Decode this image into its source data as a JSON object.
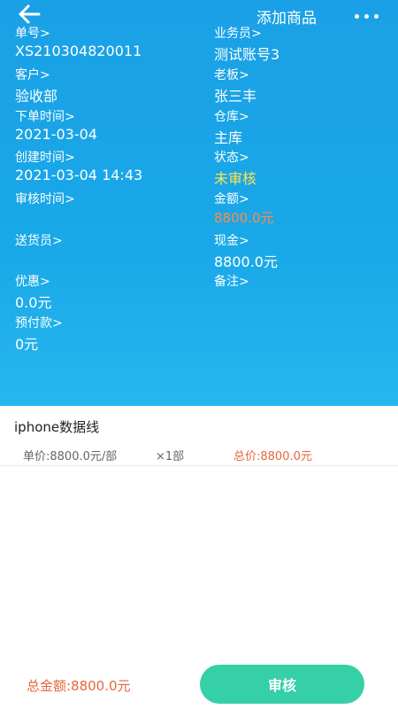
{
  "header": {
    "title": "添加商品"
  },
  "order": {
    "number_label": "单号>",
    "number_value": "XS210304820011",
    "salesperson_label": "业务员>",
    "salesperson_value": "测试账号3",
    "customer_label": "客户>",
    "customer_value": "验收部",
    "boss_label": "老板>",
    "boss_value": "张三丰",
    "order_time_label": "下单时间>",
    "order_time_value": "2021-03-04",
    "warehouse_label": "仓库>",
    "warehouse_value": "主库",
    "created_label": "创建时间>",
    "created_value": "2021-03-04 14:43",
    "status_label": "状态>",
    "status_value": "未审核",
    "review_time_label": "审核时间>",
    "amount_label": "金额>",
    "amount_value": "8800.0元",
    "deliverer_label": "送货员>",
    "cash_label": "现金>",
    "cash_value": "8800.0元",
    "discount_label": "优惠>",
    "discount_value": "0.0元",
    "remark_label": "备注>",
    "prepay_label": "预付款>",
    "prepay_value": "0元"
  },
  "item": {
    "name": "iphone数据线",
    "unit_price": "单价:8800.0元/部",
    "quantity": "×1部",
    "total": "总价:8800.0元"
  },
  "footer": {
    "total": "总金额:8800.0元",
    "approve_label": "审核"
  },
  "colors": {
    "header_bg": "#1aa0e6",
    "status_pending": "#ffe34d",
    "amount": "#ff8a4c",
    "price_total": "#e8663b",
    "approve_button": "#35d0a8"
  },
  "icons": {
    "back": "back-arrow-icon",
    "more": "more-dots-icon"
  }
}
